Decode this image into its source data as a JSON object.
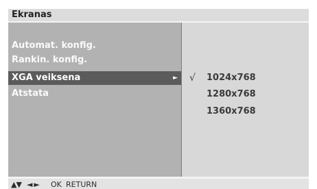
{
  "title": "Ekranas",
  "menu": {
    "items": [
      {
        "label": "Automat. konfig."
      },
      {
        "label": "Rankin. konfig."
      },
      {
        "label": "XGA veiksena",
        "arrow": "►"
      },
      {
        "label": "Atstata"
      }
    ],
    "selected_index": 2
  },
  "options": {
    "items": [
      {
        "check": "√",
        "label": "1024x768"
      },
      {
        "check": "",
        "label": "1280x768"
      },
      {
        "check": "",
        "label": "1360x768"
      }
    ],
    "checked_index": 0
  },
  "footer": {
    "icons": [
      "▲",
      "▼",
      "◄",
      "►"
    ],
    "ok_label": "OK",
    "return_label": "RETURN"
  }
}
